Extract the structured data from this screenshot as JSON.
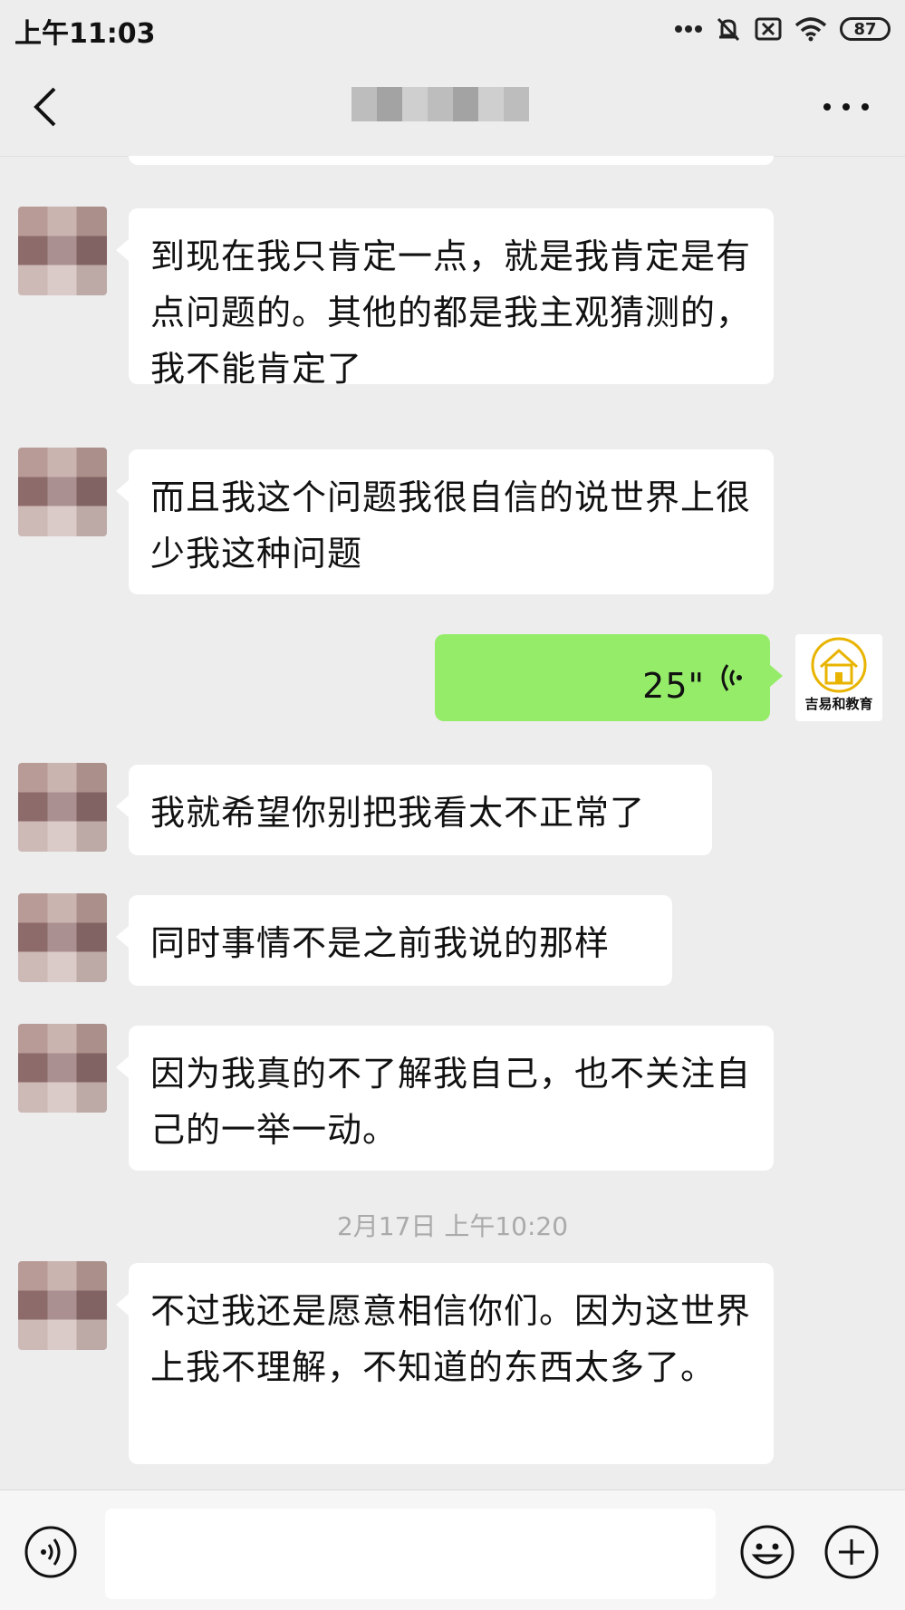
{
  "status_bar": {
    "time": "上午11:03",
    "battery": "87"
  },
  "nav": {
    "title": ""
  },
  "messages": [
    {
      "side": "left",
      "text": "到现在我只肯定一点，就是我肯定是有点问题的。其他的都是我主观猜测的，我不能肯定了"
    },
    {
      "side": "left",
      "text": "而且我这个问题我很自信的说世界上很少我这种问题"
    },
    {
      "side": "right",
      "type": "voice",
      "duration": "25\"",
      "avatar_label": "吉易和教育"
    },
    {
      "side": "left",
      "text": "我就希望你别把我看太不正常了"
    },
    {
      "side": "left",
      "text": "同时事情不是之前我说的那样"
    },
    {
      "side": "left",
      "text": "因为我真的不了解我自己，也不关注自己的一举一动。"
    },
    {
      "type": "timestamp",
      "text": "2月17日 上午10:20"
    },
    {
      "side": "left",
      "text": "不过我还是愿意相信你们。因为这世界上我不理解，不知道的东西太多了。"
    }
  ],
  "input_bar": {
    "placeholder": ""
  },
  "colors": {
    "background": "#ededed",
    "my_bubble": "#95ec69",
    "their_bubble": "#ffffff"
  }
}
